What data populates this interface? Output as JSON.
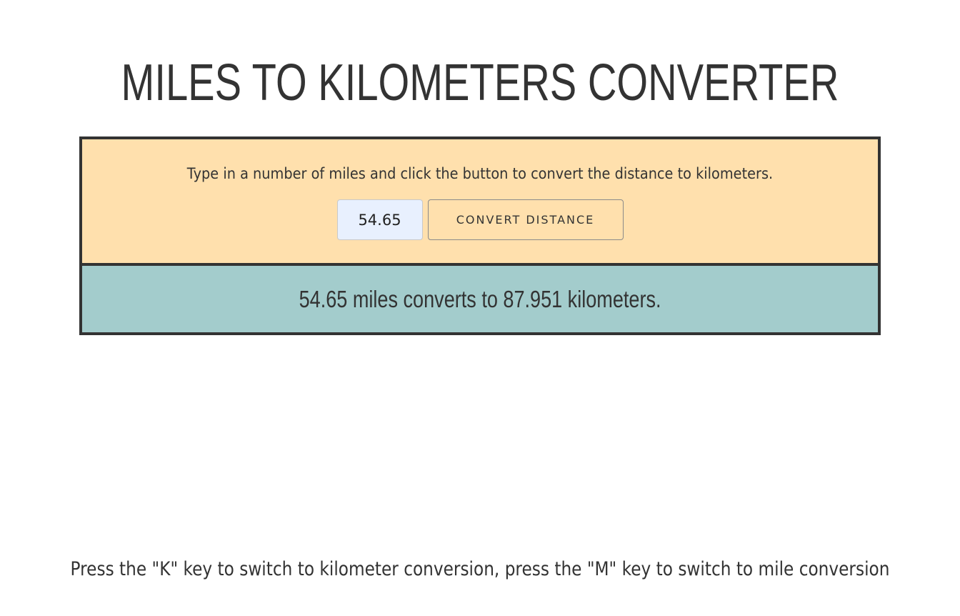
{
  "header": {
    "title": "MILES TO KILOMETERS CONVERTER"
  },
  "converter": {
    "instructions": "Type in a number of miles and click the button to convert the distance to kilometers.",
    "input_value": "54.65",
    "button_label": "CONVERT DISTANCE",
    "result_text": "54.65 miles converts to 87.951 kilometers."
  },
  "footer": {
    "hint": "Press the \"K\" key to switch to kilometer conversion, press the \"M\" key to switch to mile conversion"
  },
  "colors": {
    "input_panel_bg": "#ffe0ad",
    "result_panel_bg": "#a3cccc",
    "border": "#333333",
    "input_bg": "#e8f0fe",
    "text": "#333333"
  }
}
